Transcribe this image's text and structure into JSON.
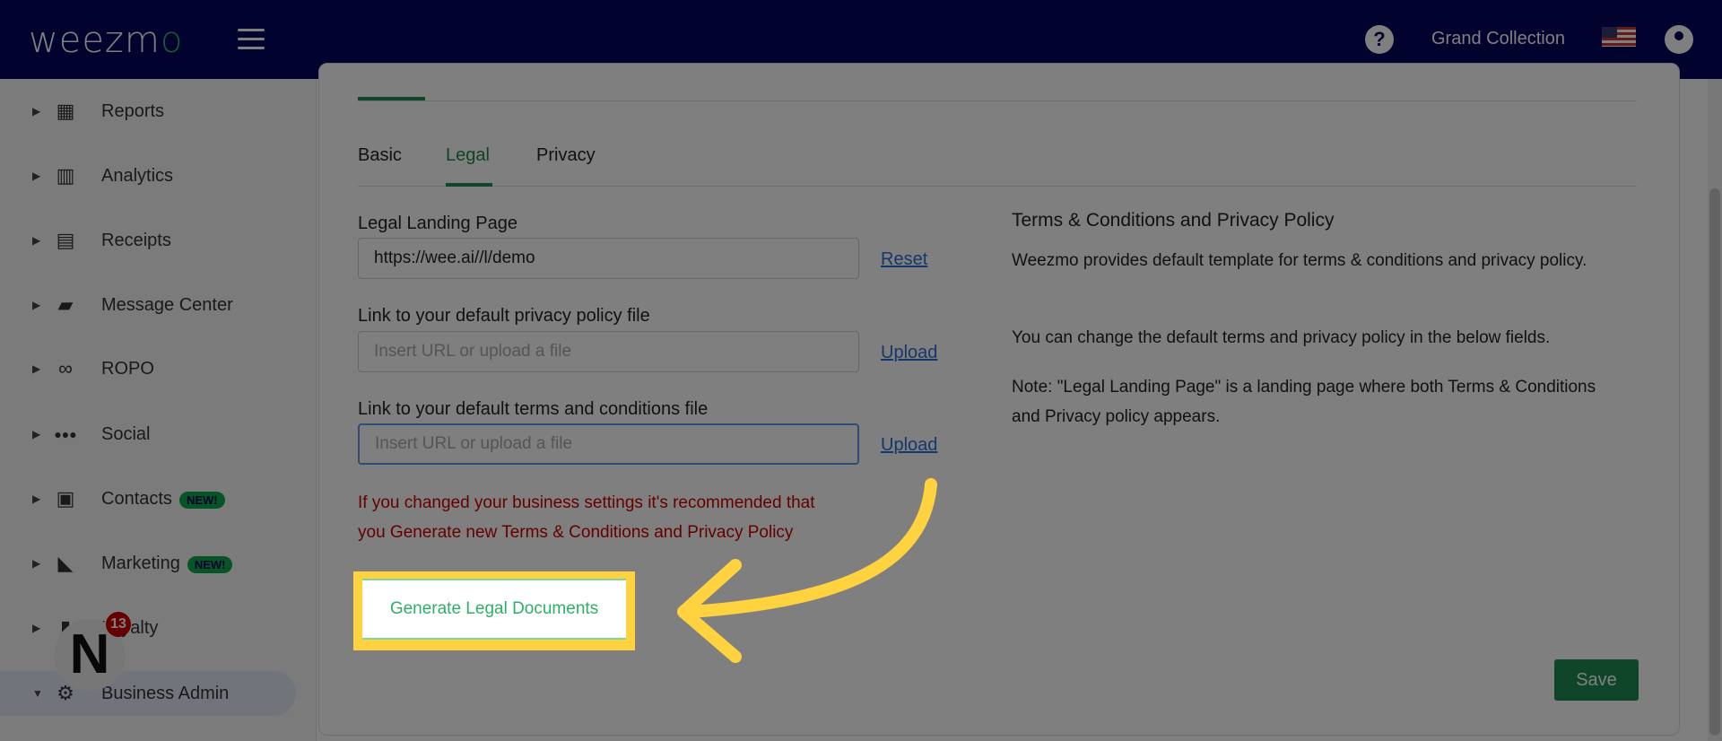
{
  "header": {
    "logo": "weezmo",
    "business": "Grand Collection",
    "help_icon": "question-circle-icon",
    "flag_icon": "us-flag-icon",
    "user_icon": "account-circle-icon",
    "brand_color": "#02045a"
  },
  "sidebar": {
    "items": [
      {
        "label": "Reports",
        "icon": "dashboard-icon"
      },
      {
        "label": "Analytics",
        "icon": "analytics-icon"
      },
      {
        "label": "Receipts",
        "icon": "receipt-icon"
      },
      {
        "label": "Message Center",
        "icon": "chat-icon"
      },
      {
        "label": "ROPO",
        "icon": "infinity-icon"
      },
      {
        "label": "Social",
        "icon": "people-icon"
      },
      {
        "label": "Contacts",
        "icon": "contacts-icon",
        "badge": "NEW!"
      },
      {
        "label": "Marketing",
        "icon": "party-popper-icon",
        "badge": "NEW!"
      },
      {
        "label": "Loyalty",
        "icon": "loyalty-icon"
      },
      {
        "label": "Business Admin",
        "icon": "gear-icon",
        "active": true
      }
    ],
    "notification": {
      "letter": "N",
      "count": "13"
    }
  },
  "tabs": [
    {
      "label": "Basic"
    },
    {
      "label": "Legal",
      "active": true
    },
    {
      "label": "Privacy"
    }
  ],
  "form": {
    "landing": {
      "label": "Legal Landing Page",
      "value": "https://wee.ai//l/demo",
      "action": "Reset"
    },
    "privacy": {
      "label": "Link to your default privacy policy file",
      "placeholder": "Insert URL or upload a file",
      "action": "Upload"
    },
    "terms": {
      "label": "Link to your default terms and conditions file",
      "placeholder": "Insert URL or upload a file",
      "action": "Upload"
    },
    "warning": "If you changed your business settings it's recommended that you Generate new Terms & Conditions and Privacy Policy",
    "generate": "Generate Legal Documents",
    "save": "Save"
  },
  "info": {
    "title": "Terms & Conditions and Privacy Policy",
    "p1": "Weezmo provides default template for terms & conditions and privacy policy.",
    "p2": "You can change the default terms and privacy policy in the below fields.",
    "p3": "Note: \"Legal Landing Page\" is a landing page where both Terms & Conditions and Privacy policy appears."
  },
  "colors": {
    "accent": "#1f8a52",
    "highlight": "#ffd23f",
    "warning": "#cc0000",
    "link": "#2a6fd6"
  }
}
